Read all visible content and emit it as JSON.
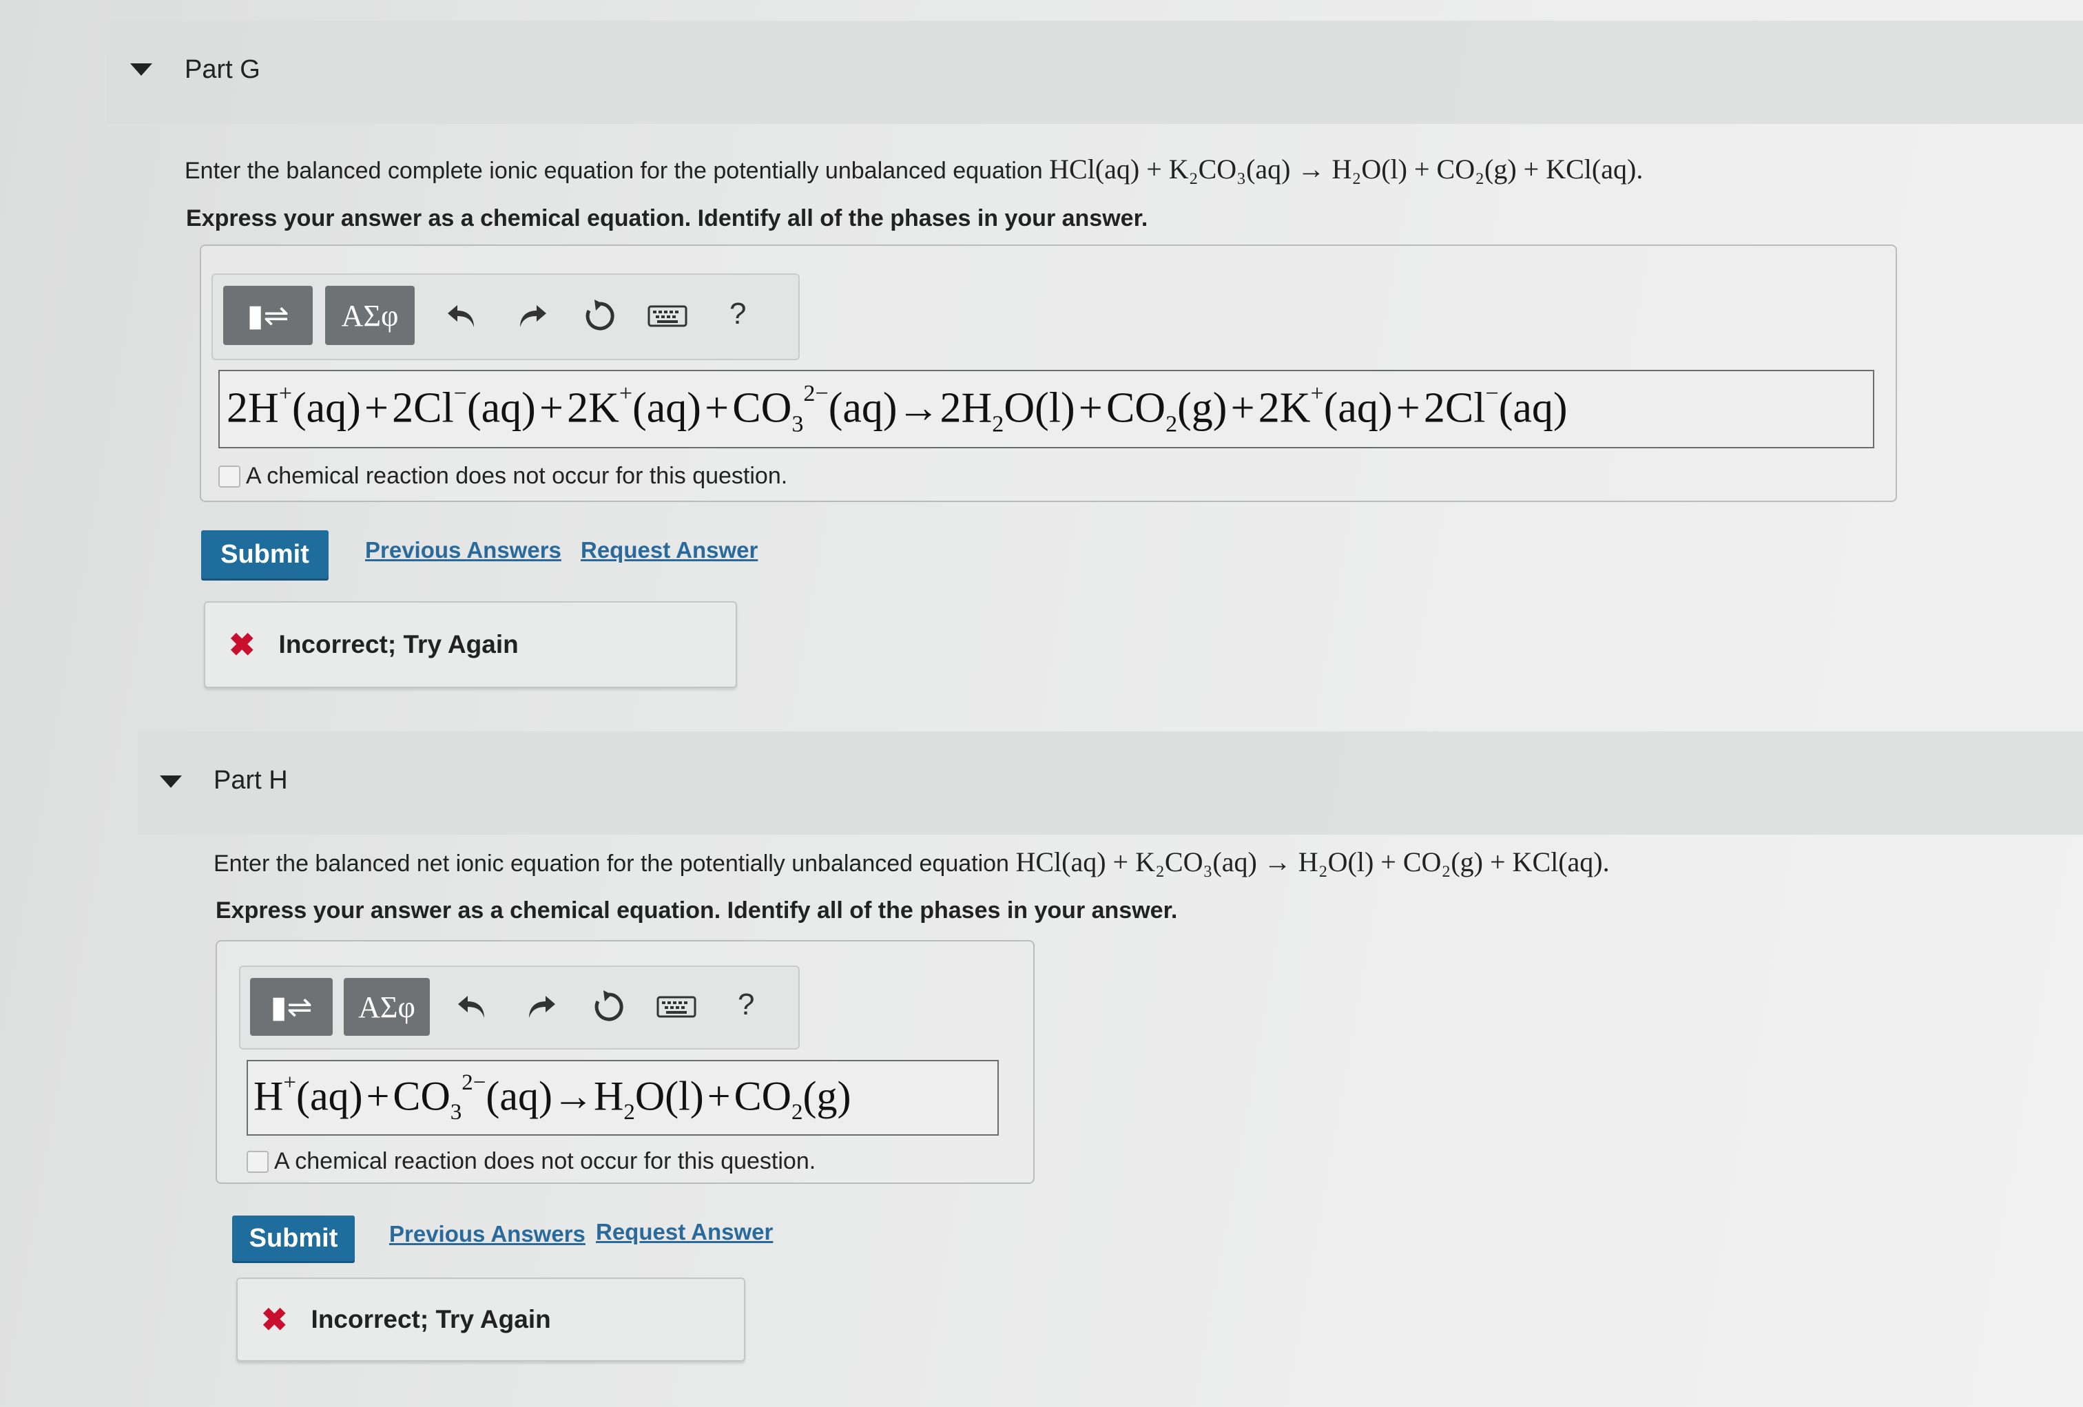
{
  "parts": [
    {
      "title": "Part G",
      "prompt_text": "Enter the balanced complete ionic equation for the potentially unbalanced equation",
      "prompt_equation": "HCl(aq) + K₂CO₃(aq) → H₂O(l) + CO₂(g) + KCl(aq).",
      "instruction": "Express your answer as a chemical equation. Identify all of the phases in your answer.",
      "toolbar": {
        "templates": "▮⇌",
        "symbols": "ΑΣφ",
        "undo": "undo-icon",
        "redo": "redo-icon",
        "reset": "reset-icon",
        "keyboard": "keyboard-icon",
        "help": "?"
      },
      "answer": "2H⁺(aq)+2Cl⁻(aq)+2K⁺(aq)+CO₃²⁻(aq)→2H₂O(l)+CO₂(g)+2K⁺(aq)+2Cl⁻(aq)",
      "no_reaction_label": "A chemical reaction does not occur for this question.",
      "submit_label": "Submit",
      "previous_answers_label": "Previous Answers",
      "request_answer_label": "Request Answer",
      "feedback": "Incorrect; Try Again"
    },
    {
      "title": "Part H",
      "prompt_text": "Enter the balanced net ionic equation for the potentially unbalanced equation",
      "prompt_equation": "HCl(aq) + K₂CO₃(aq) → H₂O(l) + CO₂(g) + KCl(aq).",
      "instruction": "Express your answer as a chemical equation. Identify all of the phases in your answer.",
      "toolbar": {
        "templates": "▮⇌",
        "symbols": "ΑΣφ",
        "undo": "undo-icon",
        "redo": "redo-icon",
        "reset": "reset-icon",
        "keyboard": "keyboard-icon",
        "help": "?"
      },
      "answer": "H⁺(aq)+CO₃²⁻(aq)→H₂O(l)+CO₂(g)",
      "no_reaction_label": "A chemical reaction does not occur for this question.",
      "submit_label": "Submit",
      "previous_answers_label": "Previous Answers",
      "request_answer_label": "Request Answer",
      "feedback": "Incorrect; Try Again"
    }
  ],
  "colors": {
    "submit": "#1f6d9c",
    "link": "#2a6a9a",
    "error_x": "#c8102e"
  }
}
